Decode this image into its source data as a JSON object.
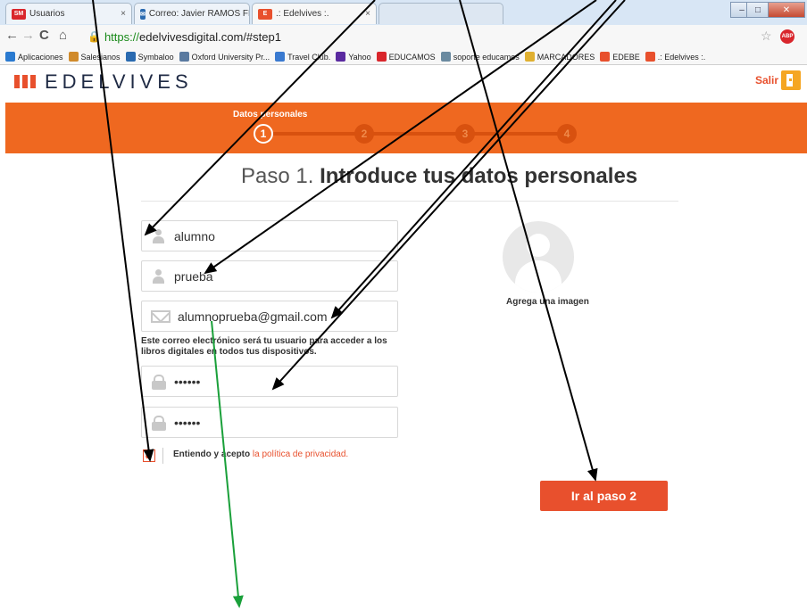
{
  "browser": {
    "tabs": [
      {
        "label": "Usuarios",
        "favicon": "SM",
        "favicon_color": "#d9262c",
        "active": false
      },
      {
        "label": "Correo: Javier RAMOS FER",
        "favicon": "✉",
        "favicon_color": "#2a6ab0",
        "active": false
      },
      {
        "label": ".: Edelvives :.",
        "favicon": "E",
        "favicon_color": "#e8502d",
        "active": true
      }
    ],
    "tab_close": "×",
    "window_controls": {
      "minimize": "–",
      "maximize": "□",
      "close": "✕"
    },
    "nav": {
      "back": "←",
      "forward": "→",
      "reload": "C",
      "home": "⌂"
    },
    "url": {
      "scheme": "https://",
      "host_path": "edelvivesdigital.com/#step1"
    },
    "bookmarks": [
      {
        "label": "Aplicaciones",
        "icon": "apps-grid-icon",
        "color": "#2a7ad0"
      },
      {
        "label": "Salesianos",
        "icon": "salesianos-icon",
        "color": "#d08a2a"
      },
      {
        "label": "Symbaloo",
        "icon": "symbaloo-icon",
        "color": "#2a6ab0"
      },
      {
        "label": "Oxford University Pr...",
        "icon": "oxford-icon",
        "color": "#5a7aa0"
      },
      {
        "label": "Travel Club.",
        "icon": "travel-club-icon",
        "color": "#3a7ad0"
      },
      {
        "label": "Yahoo",
        "icon": "yahoo-icon",
        "color": "#5a2aa0"
      },
      {
        "label": "EDUCAMOS",
        "icon": "educamos-icon",
        "color": "#d9262c"
      },
      {
        "label": "soporte educamos",
        "icon": "soporte-icon",
        "color": "#6a8aa0"
      },
      {
        "label": "MARCADORES",
        "icon": "folder-icon",
        "color": "#e0b030"
      },
      {
        "label": "EDEBE",
        "icon": "edebe-icon",
        "color": "#e8502d"
      },
      {
        "label": ".: Edelvives :.",
        "icon": "edelvives-icon",
        "color": "#e8502d"
      }
    ]
  },
  "page": {
    "logo": "EDELVIVES",
    "logout_label": "Salir",
    "stepper": {
      "caption": "Datos personales",
      "steps": [
        "1",
        "2",
        "3",
        "4"
      ],
      "current_step": 1
    },
    "heading_light": "Paso 1.",
    "heading_bold": "Introduce tus datos personales",
    "form": {
      "first_name": "alumno",
      "last_name": "prueba",
      "email": "alumnoprueba@gmail.com",
      "email_note": "Este correo electrónico será tu usuario para acceder a los libros digitales en todos tus dispositivos.",
      "password": "••••••",
      "password_confirm": "••••••",
      "terms_checked": true,
      "terms_check_glyph": "✔",
      "terms_text": "Entiendo y acepto",
      "terms_link": "la política de privacidad."
    },
    "avatar_label": "Agrega una imagen",
    "next_button": "Ir al paso 2"
  },
  "colors": {
    "brand_orange": "#ef6820",
    "accent_red": "#e8502d",
    "annotation_black": "#000000",
    "annotation_green": "#1aa03a"
  }
}
